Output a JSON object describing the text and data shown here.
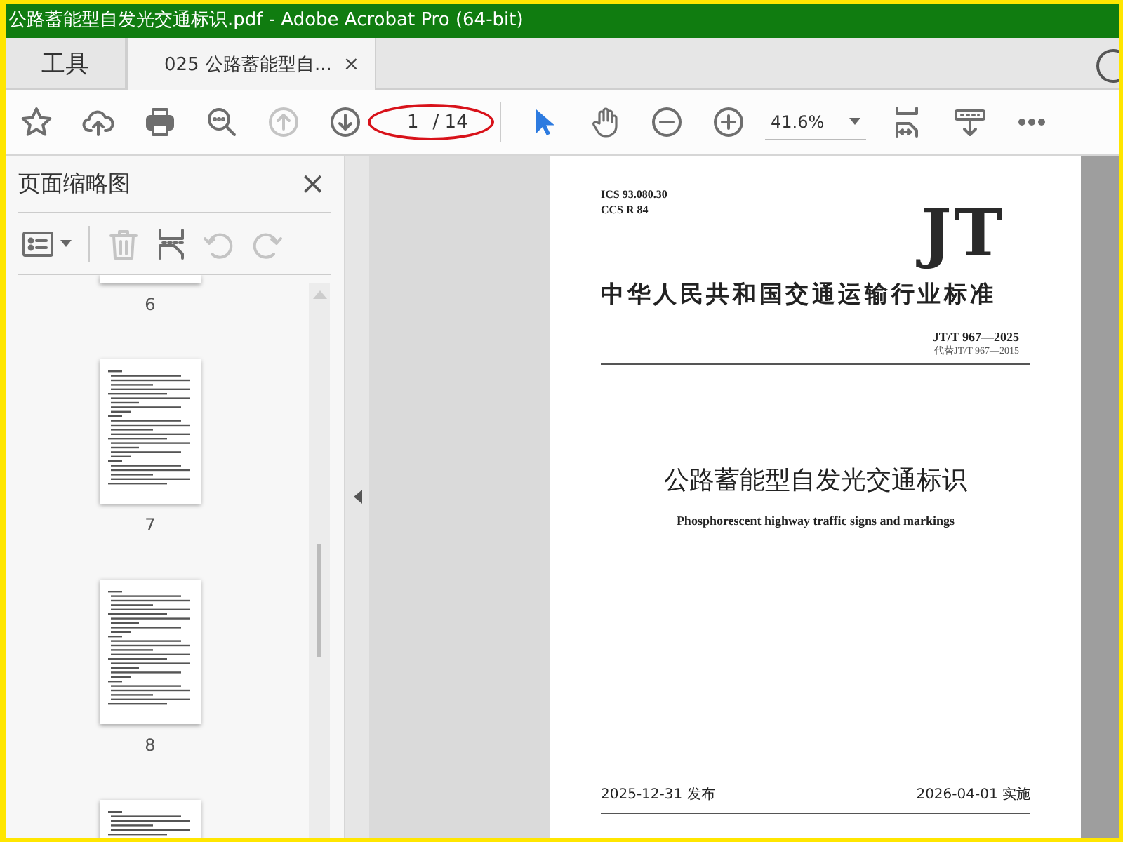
{
  "window": {
    "title": "公路蓄能型自发光交通标识.pdf - Adobe Acrobat Pro (64-bit)"
  },
  "tabs": [
    {
      "label": "工具",
      "selected": false
    },
    {
      "label": "025 公路蓄能型自...",
      "selected": true,
      "close": "×"
    }
  ],
  "toolbar": [
    {
      "kind": "star",
      "disabled": false
    },
    {
      "kind": "upload",
      "disabled": false
    },
    {
      "kind": "print",
      "disabled": false
    },
    {
      "kind": "search",
      "disabled": false
    },
    {
      "kind": "prev",
      "disabled": true
    },
    {
      "kind": "next",
      "disabled": false
    },
    {
      "kind": "page",
      "value": "1",
      "total": "/ 14"
    },
    {
      "kind": "separator"
    },
    {
      "kind": "pointer",
      "selected": true
    },
    {
      "kind": "hand",
      "selected": false
    },
    {
      "kind": "zoom-out",
      "disabled": false
    },
    {
      "kind": "zoom-in",
      "disabled": false
    },
    {
      "kind": "zoom",
      "value": "41.6%"
    },
    {
      "kind": "fit",
      "disabled": false
    },
    {
      "kind": "read",
      "disabled": false
    },
    {
      "kind": "more",
      "disabled": false
    }
  ],
  "sidebar": {
    "title": "页面缩略图",
    "close": "×",
    "tools": [
      {
        "kind": "options",
        "disabled": false
      },
      {
        "kind": "delete",
        "disabled": true
      },
      {
        "kind": "insert",
        "disabled": false
      },
      {
        "kind": "undo",
        "disabled": true
      },
      {
        "kind": "redo",
        "disabled": true
      }
    ],
    "thumbnails": [
      {
        "kind": "cut-top",
        "label": "6"
      },
      {
        "kind": "full",
        "label": "7"
      },
      {
        "kind": "full",
        "label": "8"
      },
      {
        "kind": "cut-bottom"
      }
    ]
  },
  "document": {
    "ics": "ICS 93.080.30",
    "ccs": "CCS R 84",
    "logo": "JT",
    "org": "中华人民共和国交通运输行业标准",
    "code": "JT/T 967—2025",
    "replaces": "代替JT/T 967—2015",
    "title_cn": "公路蓄能型自发光交通标识",
    "title_en": "Phosphorescent highway traffic signs and markings",
    "issued": "2025-12-31 发布",
    "effective": "2026-04-01 实施"
  }
}
